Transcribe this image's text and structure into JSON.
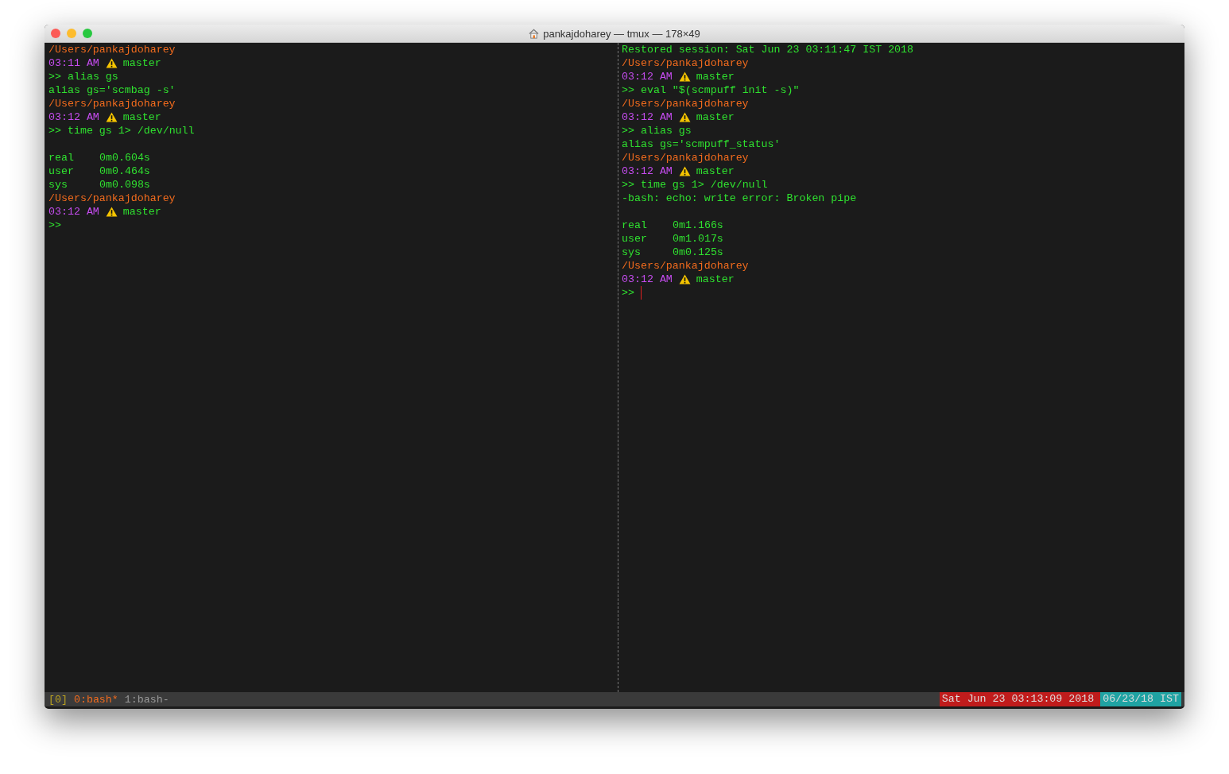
{
  "window": {
    "title": "pankajdoharey — tmux — 178×49"
  },
  "panes": [
    {
      "lines": [
        {
          "kind": "path",
          "text": "/Users/pankajdoharey"
        },
        {
          "kind": "prompt",
          "time": "03:11 AM",
          "branch": "master"
        },
        {
          "kind": "command",
          "marker": ">>",
          "text": "alias gs",
          "cursor": false
        },
        {
          "kind": "output",
          "text": "alias gs='scmbag -s'"
        },
        {
          "kind": "path",
          "text": "/Users/pankajdoharey"
        },
        {
          "kind": "prompt",
          "time": "03:12 AM",
          "branch": "master"
        },
        {
          "kind": "command",
          "marker": ">>",
          "text": "time gs 1> /dev/null",
          "cursor": false
        },
        {
          "kind": "blank"
        },
        {
          "kind": "timing",
          "label": "real",
          "value": "0m0.604s"
        },
        {
          "kind": "timing",
          "label": "user",
          "value": "0m0.464s"
        },
        {
          "kind": "timing",
          "label": "sys",
          "value": "0m0.098s"
        },
        {
          "kind": "path",
          "text": "/Users/pankajdoharey"
        },
        {
          "kind": "prompt",
          "time": "03:12 AM",
          "branch": "master"
        },
        {
          "kind": "command",
          "marker": ">>",
          "cursor": false
        }
      ]
    },
    {
      "lines": [
        {
          "kind": "output",
          "text": "Restored session: Sat Jun 23 03:11:47 IST 2018"
        },
        {
          "kind": "path",
          "text": "/Users/pankajdoharey"
        },
        {
          "kind": "prompt",
          "time": "03:12 AM",
          "branch": "master"
        },
        {
          "kind": "command",
          "marker": ">>",
          "text": "eval \"$(scmpuff init -s)\"",
          "cursor": false
        },
        {
          "kind": "path",
          "text": "/Users/pankajdoharey"
        },
        {
          "kind": "prompt",
          "time": "03:12 AM",
          "branch": "master"
        },
        {
          "kind": "command",
          "marker": ">>",
          "text": "alias gs",
          "cursor": false
        },
        {
          "kind": "output",
          "text": "alias gs='scmpuff_status'"
        },
        {
          "kind": "path",
          "text": "/Users/pankajdoharey"
        },
        {
          "kind": "prompt",
          "time": "03:12 AM",
          "branch": "master"
        },
        {
          "kind": "command",
          "marker": ">>",
          "text": "time gs 1> /dev/null",
          "cursor": false
        },
        {
          "kind": "output",
          "text": "-bash: echo: write error: Broken pipe"
        },
        {
          "kind": "blank"
        },
        {
          "kind": "timing",
          "label": "real",
          "value": "0m1.166s"
        },
        {
          "kind": "timing",
          "label": "user",
          "value": "0m1.017s"
        },
        {
          "kind": "timing",
          "label": "sys",
          "value": "0m0.125s"
        },
        {
          "kind": "path",
          "text": "/Users/pankajdoharey"
        },
        {
          "kind": "prompt",
          "time": "03:12 AM",
          "branch": "master"
        },
        {
          "kind": "command",
          "marker": ">>",
          "cursor": true
        }
      ]
    }
  ],
  "status_bar": {
    "session": "[0]",
    "windows": [
      {
        "label": "0:bash*",
        "selected": true
      },
      {
        "label": "1:bash-",
        "selected": false
      }
    ],
    "datetime": "Sat Jun 23 03:13:09 2018",
    "date": "06/23/18 IST"
  }
}
